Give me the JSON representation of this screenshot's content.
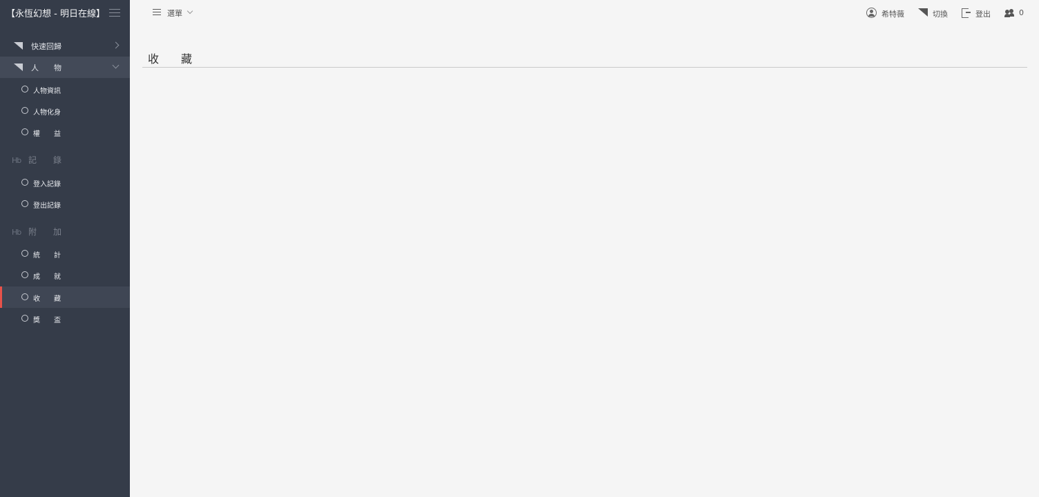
{
  "brand": {
    "title": "【永恆幻想 - 明日在線】"
  },
  "sidebar": {
    "groups": [
      {
        "label": "快速回歸"
      },
      {
        "label": "人　　物"
      }
    ],
    "people_items": [
      {
        "label": "人物資訊"
      },
      {
        "label": "人物化身"
      },
      {
        "label": "權　　益"
      }
    ],
    "sections": [
      {
        "label": "記　　錄"
      },
      {
        "label": "附　　加"
      }
    ],
    "record_items": [
      {
        "label": "登入記錄"
      },
      {
        "label": "登出記錄"
      }
    ],
    "extra_items": [
      {
        "label": "統　　計"
      },
      {
        "label": "成　　就"
      },
      {
        "label": "收　　藏"
      },
      {
        "label": "獎　　盃"
      }
    ],
    "active_item": "收　　藏"
  },
  "topbar": {
    "menu_label": "選單",
    "user_label": "希特薇",
    "switch_label": "切換",
    "logout_label": "登出",
    "online_count": "0"
  },
  "main": {
    "title": "收　　藏"
  },
  "colors": {
    "sidebar_bg": "#353c49",
    "active_accent": "#e8524a",
    "page_bg": "#f5f5f5"
  }
}
